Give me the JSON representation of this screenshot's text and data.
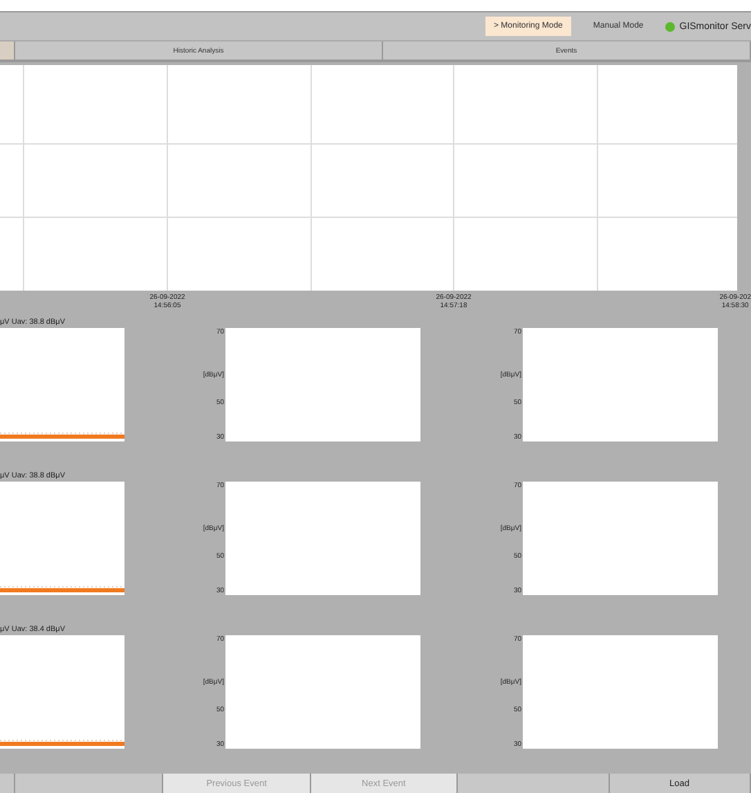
{
  "toolbar": {
    "modes": [
      {
        "label": "> Monitoring Mode",
        "selected": true
      },
      {
        "label": "Manual Mode",
        "selected": false
      }
    ],
    "server": {
      "label": "GISmonitor Serv",
      "color": "#5cb82c"
    }
  },
  "tabs": [
    {
      "label": "Historic Analysis",
      "selected": false
    },
    {
      "label": "Events",
      "selected": false
    }
  ],
  "overview": {
    "x_labels": [
      {
        "date": "26-09-2022",
        "time": "14:56:05"
      },
      {
        "date": "26-09-2022",
        "time": "14:57:18"
      },
      {
        "date": "26-09-202",
        "time": "14:58:30"
      }
    ]
  },
  "rows": [
    {
      "summary": "μV  Uav: 38.8 dBμV",
      "charts": [
        {
          "ticks": [
            "70",
            "50",
            "30"
          ],
          "unit": "[dBμV]"
        },
        {
          "ticks": [
            "70",
            "50",
            "30"
          ],
          "unit": "[dBμV]"
        }
      ]
    },
    {
      "summary": "μV  Uav: 38.8 dBμV",
      "charts": [
        {
          "ticks": [
            "70",
            "50",
            "30"
          ],
          "unit": "[dBμV]"
        },
        {
          "ticks": [
            "70",
            "50",
            "30"
          ],
          "unit": "[dBμV]"
        }
      ]
    },
    {
      "summary": "μV  Uav: 38.4 dBμV",
      "charts": [
        {
          "ticks": [
            "70",
            "50",
            "30"
          ],
          "unit": "[dBμV]"
        },
        {
          "ticks": [
            "70",
            "50",
            "30"
          ],
          "unit": "[dBμV]"
        }
      ]
    }
  ],
  "bottom_buttons": [
    {
      "label": "Previous Event",
      "disabled": true
    },
    {
      "label": "Next Event",
      "disabled": true
    },
    {
      "label": "Load",
      "disabled": false
    }
  ]
}
